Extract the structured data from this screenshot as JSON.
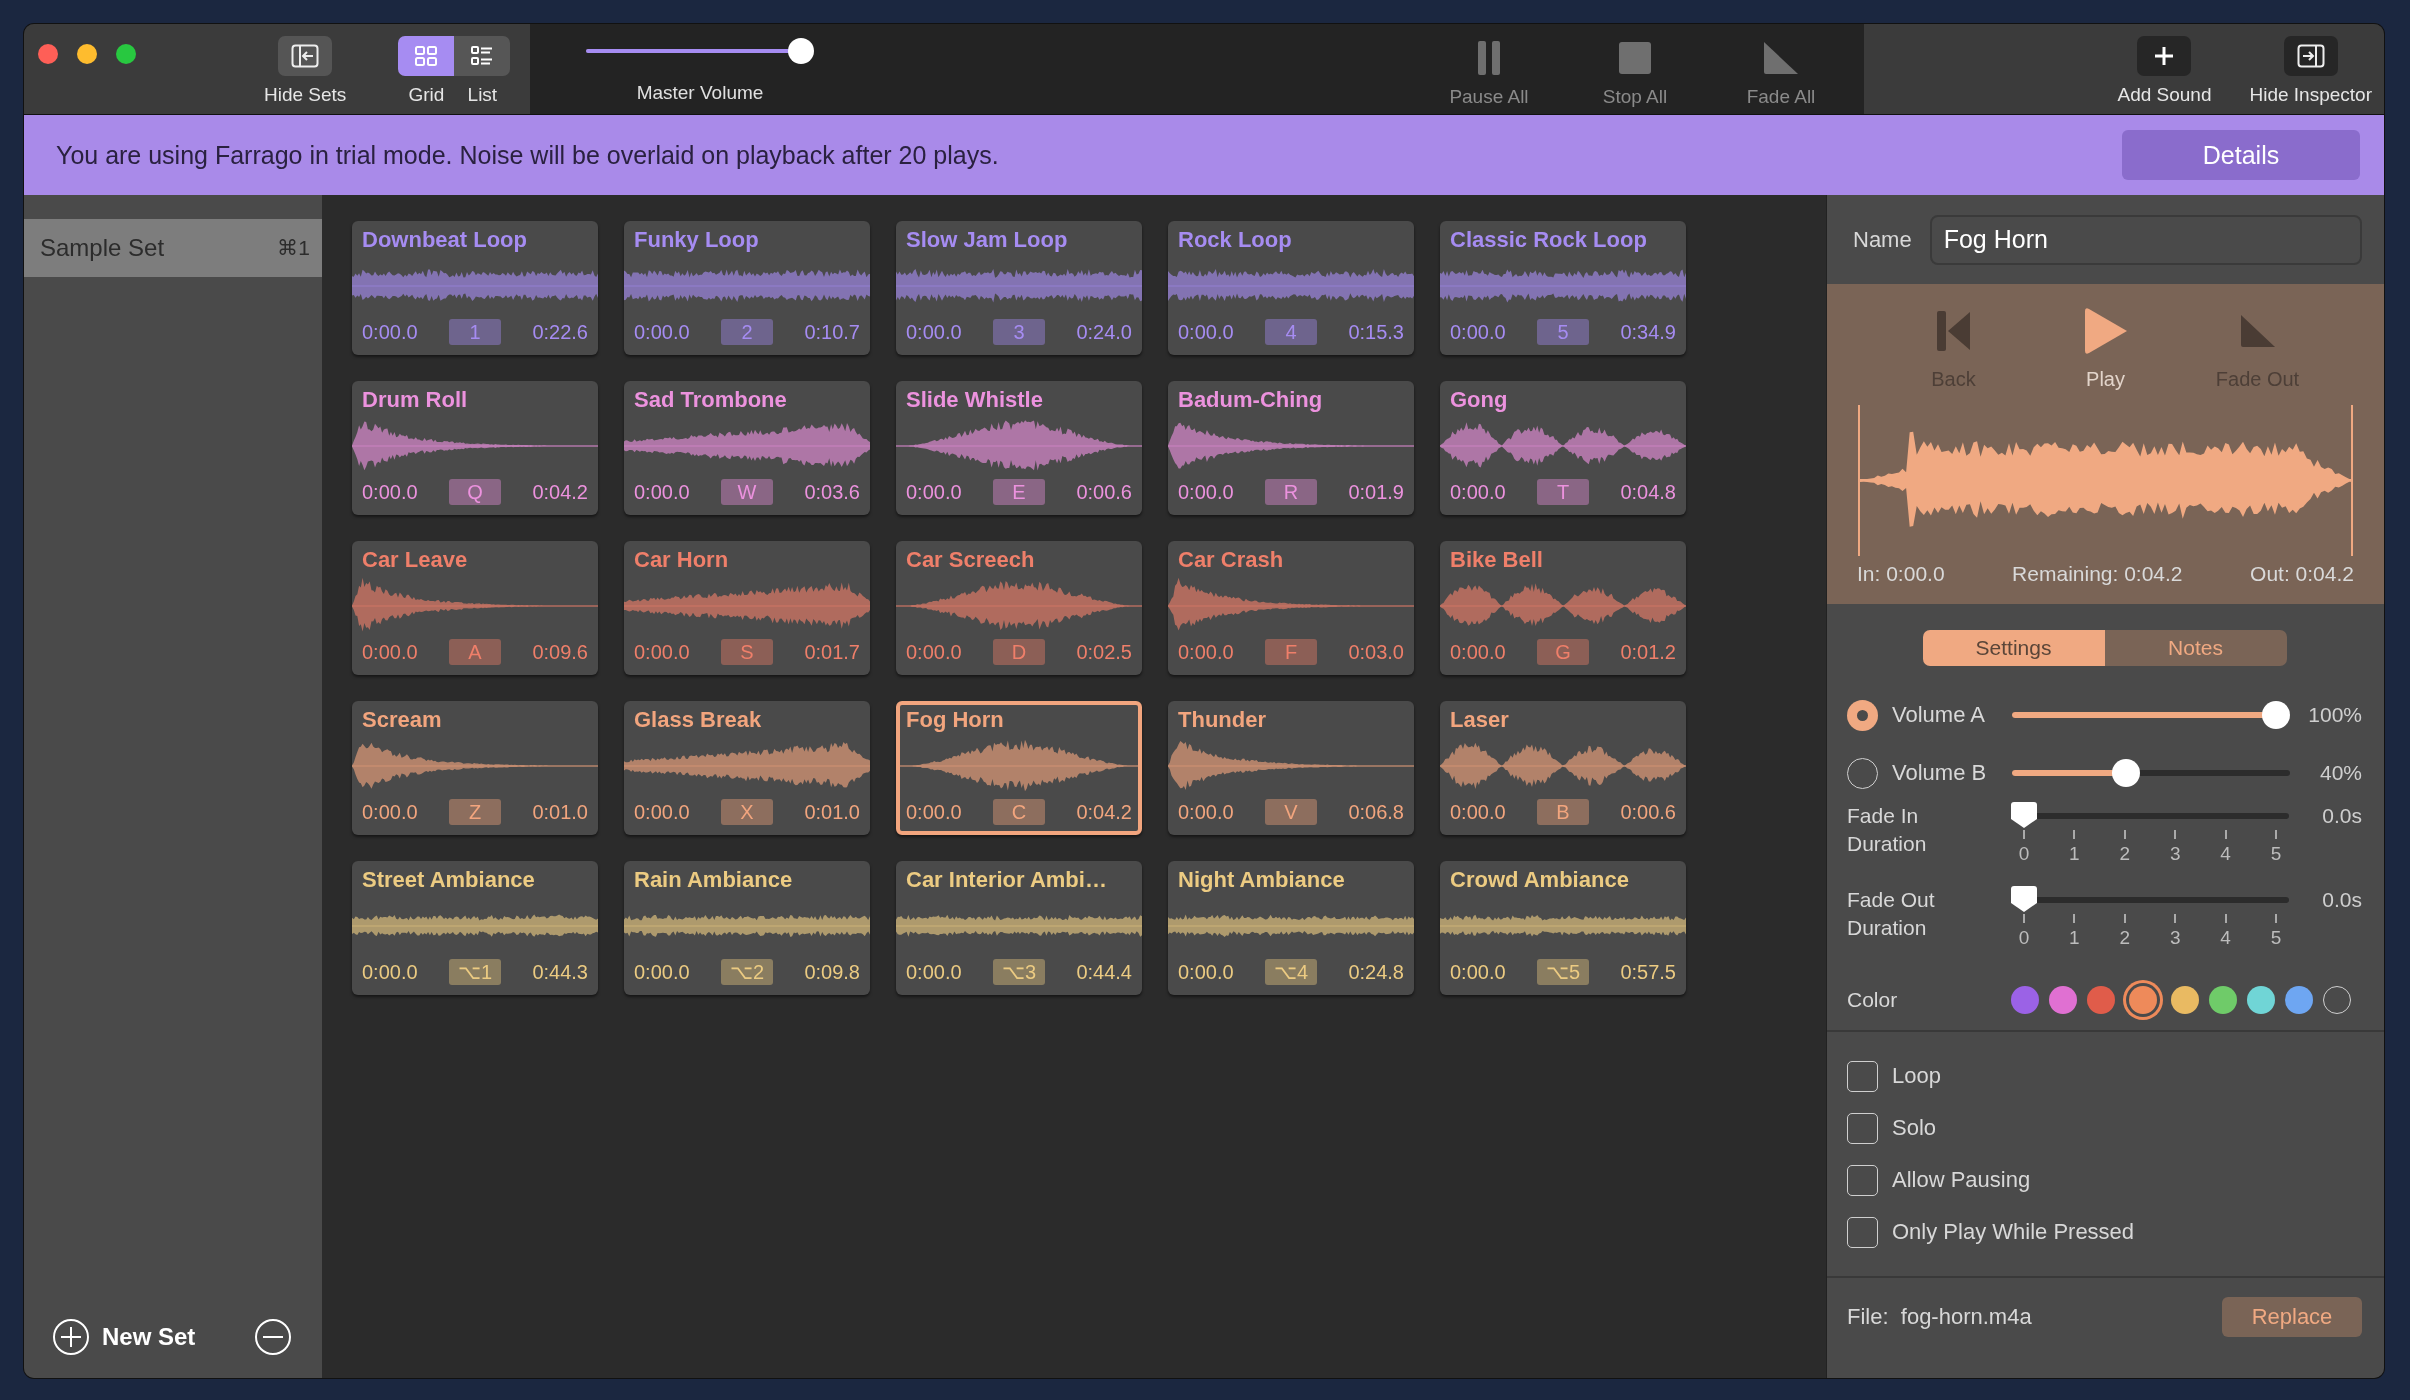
{
  "toolbar": {
    "hide_sets": "Hide Sets",
    "view_modes": [
      {
        "label": "Grid",
        "kind": "grid",
        "selected": true
      },
      {
        "label": "List",
        "kind": "list",
        "selected": false
      }
    ],
    "master_volume": {
      "label": "Master Volume",
      "level": 1
    },
    "transport": [
      {
        "label": "Pause All",
        "kind": "pause",
        "disabled": true
      },
      {
        "label": "Stop All",
        "kind": "stop",
        "disabled": true
      },
      {
        "label": "Fade All",
        "kind": "fade",
        "disabled": true
      }
    ],
    "add_sound": "Add Sound",
    "hide_inspector": "Hide Inspector"
  },
  "banner": {
    "message": "You are using Farrago in trial mode. Noise will be overlaid on playback after 20 plays.",
    "button": "Details"
  },
  "sidebar": {
    "sets": [
      {
        "name": "Sample Set",
        "shortcut": "⌘1",
        "selected": true
      }
    ],
    "new_set": "New Set"
  },
  "sounds": [
    {
      "name": "Downbeat Loop",
      "start": "0:00.0",
      "key": "1",
      "end": "0:22.6",
      "color": "#a68cf2",
      "selected": false
    },
    {
      "name": "Funky Loop",
      "start": "0:00.0",
      "key": "2",
      "end": "0:10.7",
      "color": "#a68cf2",
      "selected": false
    },
    {
      "name": "Slow Jam Loop",
      "start": "0:00.0",
      "key": "3",
      "end": "0:24.0",
      "color": "#a68cf2",
      "selected": false
    },
    {
      "name": "Rock Loop",
      "start": "0:00.0",
      "key": "4",
      "end": "0:15.3",
      "color": "#a68cf2",
      "selected": false
    },
    {
      "name": "Classic Rock Loop",
      "start": "0:00.0",
      "key": "5",
      "end": "0:34.9",
      "color": "#a68cf2",
      "selected": false
    },
    {
      "name": "Drum Roll",
      "start": "0:00.0",
      "key": "Q",
      "end": "0:04.2",
      "color": "#ec92de",
      "selected": false
    },
    {
      "name": "Sad Trombone",
      "start": "0:00.0",
      "key": "W",
      "end": "0:03.6",
      "color": "#ec92de",
      "selected": false
    },
    {
      "name": "Slide Whistle",
      "start": "0:00.0",
      "key": "E",
      "end": "0:00.6",
      "color": "#ec92de",
      "selected": false
    },
    {
      "name": "Badum-Ching",
      "start": "0:00.0",
      "key": "R",
      "end": "0:01.9",
      "color": "#ec92de",
      "selected": false
    },
    {
      "name": "Gong",
      "start": "0:00.0",
      "key": "T",
      "end": "0:04.8",
      "color": "#ec92de",
      "selected": false
    },
    {
      "name": "Car Leave",
      "start": "0:00.0",
      "key": "A",
      "end": "0:09.6",
      "color": "#ef7f6a",
      "selected": false
    },
    {
      "name": "Car Horn",
      "start": "0:00.0",
      "key": "S",
      "end": "0:01.7",
      "color": "#ef7f6a",
      "selected": false
    },
    {
      "name": "Car Screech",
      "start": "0:00.0",
      "key": "D",
      "end": "0:02.5",
      "color": "#ef7f6a",
      "selected": false
    },
    {
      "name": "Car Crash",
      "start": "0:00.0",
      "key": "F",
      "end": "0:03.0",
      "color": "#ef7f6a",
      "selected": false
    },
    {
      "name": "Bike Bell",
      "start": "0:00.0",
      "key": "G",
      "end": "0:01.2",
      "color": "#ef7f6a",
      "selected": false
    },
    {
      "name": "Scream",
      "start": "0:00.0",
      "key": "Z",
      "end": "0:01.0",
      "color": "#f2a57e",
      "selected": false
    },
    {
      "name": "Glass Break",
      "start": "0:00.0",
      "key": "X",
      "end": "0:01.0",
      "color": "#f2a57e",
      "selected": false
    },
    {
      "name": "Fog Horn",
      "start": "0:00.0",
      "key": "C",
      "end": "0:04.2",
      "color": "#f2a57e",
      "selected": true
    },
    {
      "name": "Thunder",
      "start": "0:00.0",
      "key": "V",
      "end": "0:06.8",
      "color": "#f2a57e",
      "selected": false
    },
    {
      "name": "Laser",
      "start": "0:00.0",
      "key": "B",
      "end": "0:00.6",
      "color": "#f2a57e",
      "selected": false
    },
    {
      "name": "Street Ambiance",
      "start": "0:00.0",
      "key": "⌥1",
      "end": "0:44.3",
      "color": "#eccb82",
      "selected": false
    },
    {
      "name": "Rain Ambiance",
      "start": "0:00.0",
      "key": "⌥2",
      "end": "0:09.8",
      "color": "#eccb82",
      "selected": false
    },
    {
      "name": "Car Interior Ambi…",
      "start": "0:00.0",
      "key": "⌥3",
      "end": "0:44.4",
      "color": "#eccb82",
      "selected": false
    },
    {
      "name": "Night Ambiance",
      "start": "0:00.0",
      "key": "⌥4",
      "end": "0:24.8",
      "color": "#eccb82",
      "selected": false
    },
    {
      "name": "Crowd Ambiance",
      "start": "0:00.0",
      "key": "⌥5",
      "end": "0:57.5",
      "color": "#eccb82",
      "selected": false
    }
  ],
  "inspector": {
    "name_label": "Name",
    "name_value": "Fog Horn",
    "transport": [
      {
        "label": "Back",
        "kind": "back",
        "disabled": true
      },
      {
        "label": "Play",
        "kind": "play",
        "disabled": false
      },
      {
        "label": "Fade Out",
        "kind": "fade",
        "disabled": true
      }
    ],
    "in": "In: 0:00.0",
    "remaining": "Remaining: 0:04.2",
    "out": "Out: 0:04.2",
    "tabs": [
      {
        "label": "Settings",
        "selected": true
      },
      {
        "label": "Notes",
        "selected": false
      }
    ],
    "volumes": [
      {
        "label": "Volume A",
        "selected": true,
        "level": 1,
        "reading": "100%"
      },
      {
        "label": "Volume B",
        "selected": false,
        "level": 0.4,
        "reading": "40%"
      }
    ],
    "fades": [
      {
        "label": "Fade In Duration",
        "level": 0,
        "reading": "0.0s",
        "ticks": [
          "0",
          "1",
          "2",
          "3",
          "4",
          "5"
        ]
      },
      {
        "label": "Fade Out Duration",
        "level": 0,
        "reading": "0.0s",
        "ticks": [
          "0",
          "1",
          "2",
          "3",
          "4",
          "5"
        ]
      }
    ],
    "color_label": "Color",
    "swatches": [
      {
        "kind": "swatch",
        "color": "#9b62e6",
        "selected": false
      },
      {
        "kind": "swatch",
        "color": "#e070d2",
        "selected": false
      },
      {
        "kind": "swatch",
        "color": "#e05c4a",
        "selected": false
      },
      {
        "kind": "swatch",
        "color": "#ee8a5a",
        "selected": true
      },
      {
        "kind": "swatch",
        "color": "#e9ba62",
        "selected": false
      },
      {
        "kind": "swatch",
        "color": "#6fcb69",
        "selected": false
      },
      {
        "kind": "swatch",
        "color": "#70d5d6",
        "selected": false
      },
      {
        "kind": "swatch",
        "color": "#6ea6f2",
        "selected": false
      },
      {
        "kind": "none",
        "selected": false
      }
    ],
    "options": [
      {
        "label": "Loop",
        "checked": false
      },
      {
        "label": "Solo",
        "checked": false
      },
      {
        "label": "Allow Pausing",
        "checked": false
      },
      {
        "label": "Only Play While Pressed",
        "checked": false
      }
    ],
    "file": "File:  fog-horn.m4a",
    "replace": "Replace"
  }
}
